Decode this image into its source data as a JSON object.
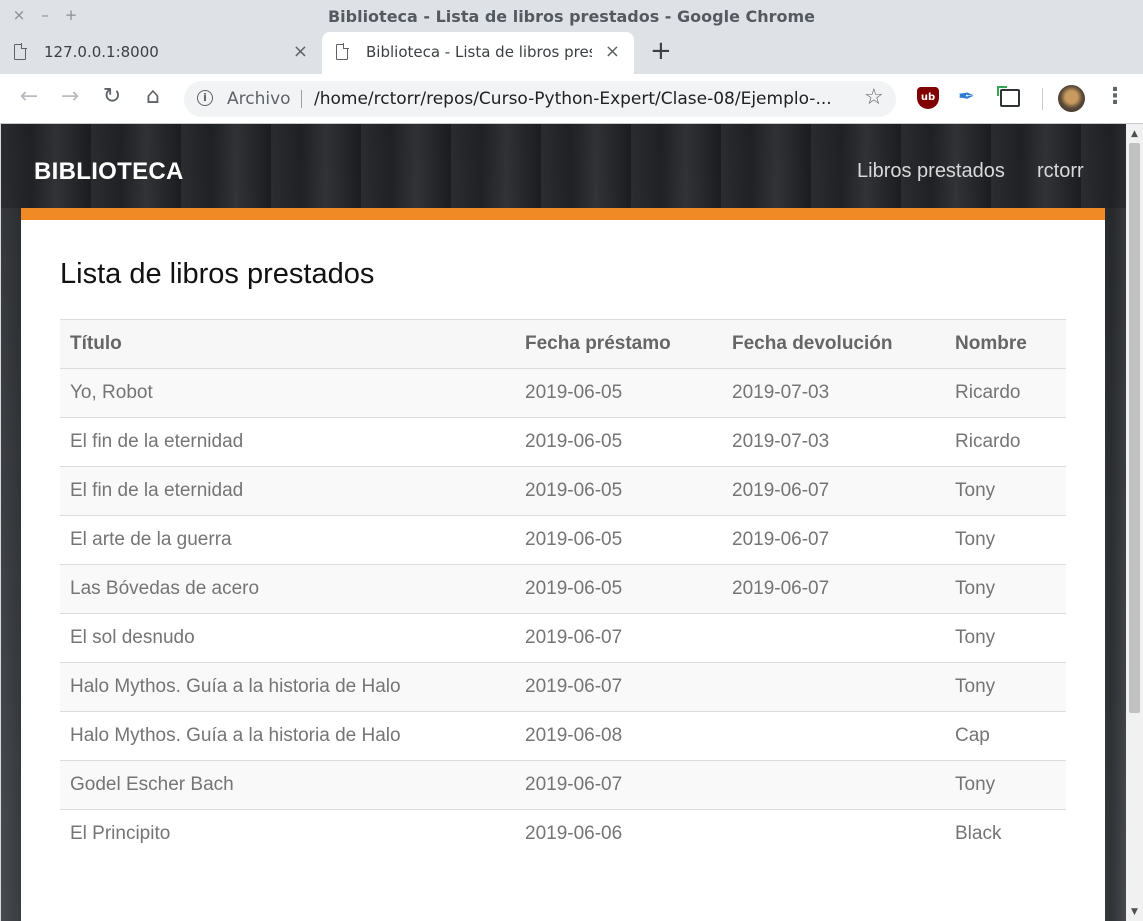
{
  "window": {
    "title": "Biblioteca - Lista de libros prestados - Google Chrome",
    "controls": [
      "×",
      "–",
      "+"
    ]
  },
  "tabs": [
    {
      "label": "127.0.0.1:8000",
      "close": "×"
    },
    {
      "label": "Biblioteca - Lista de libros prest",
      "close": "×"
    }
  ],
  "toolbar": {
    "new_tab": "+",
    "back": "←",
    "forward": "→",
    "reload": "↻",
    "home": "⌂",
    "info": "i",
    "security_label": "Archivo",
    "url": "/home/rctorr/repos/Curso-Python-Expert/Clase-08/Ejemplo-...",
    "star": "☆",
    "extension_ublock": "ub",
    "feather": "✒",
    "menu": "⋮"
  },
  "navbar": {
    "brand": "BIBLIOTECA",
    "links": [
      "Libros prestados",
      "rctorr"
    ]
  },
  "main": {
    "heading": "Lista de libros prestados",
    "columns": [
      "Título",
      "Fecha préstamo",
      "Fecha devolución",
      "Nombre"
    ],
    "rows": [
      {
        "title": "Yo, Robot",
        "loan": "2019-06-05",
        "return": "2019-07-03",
        "name": "Ricardo"
      },
      {
        "title": "El fin de la eternidad",
        "loan": "2019-06-05",
        "return": "2019-07-03",
        "name": "Ricardo"
      },
      {
        "title": "El fin de la eternidad",
        "loan": "2019-06-05",
        "return": "2019-06-07",
        "name": "Tony"
      },
      {
        "title": "El arte de la guerra",
        "loan": "2019-06-05",
        "return": "2019-06-07",
        "name": "Tony"
      },
      {
        "title": "Las Bóvedas de acero",
        "loan": "2019-06-05",
        "return": "2019-06-07",
        "name": "Tony"
      },
      {
        "title": "El sol desnudo",
        "loan": "2019-06-07",
        "return": "",
        "name": "Tony"
      },
      {
        "title": "Halo Mythos. Guía a la historia de Halo",
        "loan": "2019-06-07",
        "return": "",
        "name": "Tony"
      },
      {
        "title": "Halo Mythos. Guía a la historia de Halo",
        "loan": "2019-06-08",
        "return": "",
        "name": "Cap"
      },
      {
        "title": "Godel Escher Bach",
        "loan": "2019-06-07",
        "return": "",
        "name": "Tony"
      },
      {
        "title": "El Principito",
        "loan": "2019-06-06",
        "return": "",
        "name": "Black"
      }
    ]
  },
  "colors": {
    "accent": "#f08a24",
    "tab_active": "#ffffff",
    "chrome_frame": "#dee1e6"
  }
}
